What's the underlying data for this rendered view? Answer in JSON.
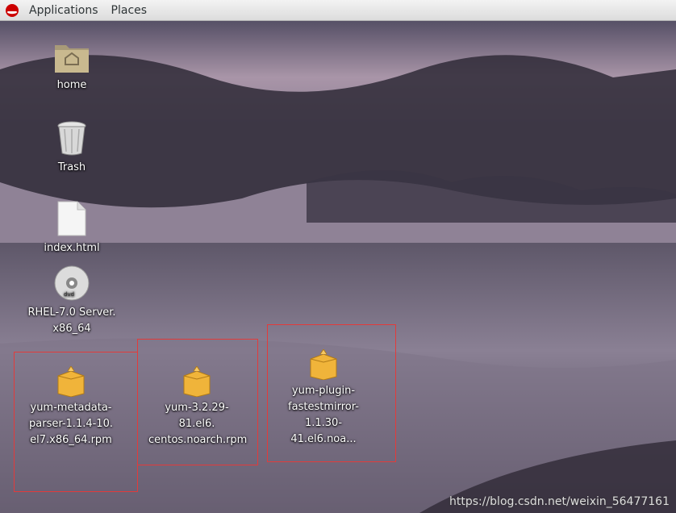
{
  "topbar": {
    "applications": "Applications",
    "places": "Places"
  },
  "desktop": {
    "icons": [
      {
        "label": "home",
        "icon": "folder-home-icon"
      },
      {
        "label": "Trash",
        "icon": "trash-icon"
      },
      {
        "label": "index.html",
        "icon": "document-icon"
      },
      {
        "label_line1": "RHEL-7.0 Server.",
        "label_line2": "x86_64",
        "icon": "dvd-icon"
      },
      {
        "label_line1": "yum-metadata-",
        "label_line2": "parser-1.1.4-10.",
        "label_line3": "el7.x86_64.rpm",
        "icon": "package-icon"
      },
      {
        "label_line1": "yum-3.2.29-81.el6.",
        "label_line2": "centos.noarch.rpm",
        "icon": "package-icon"
      },
      {
        "label_line1": "yum-plugin-",
        "label_line2": "fastestmirror-",
        "label_line3": "1.1.30-41.el6.noa...",
        "icon": "package-icon"
      }
    ]
  },
  "watermark": "https://blog.csdn.net/weixin_56477161",
  "colors": {
    "selection": "#e23b3b",
    "package": "#f0b43a"
  }
}
